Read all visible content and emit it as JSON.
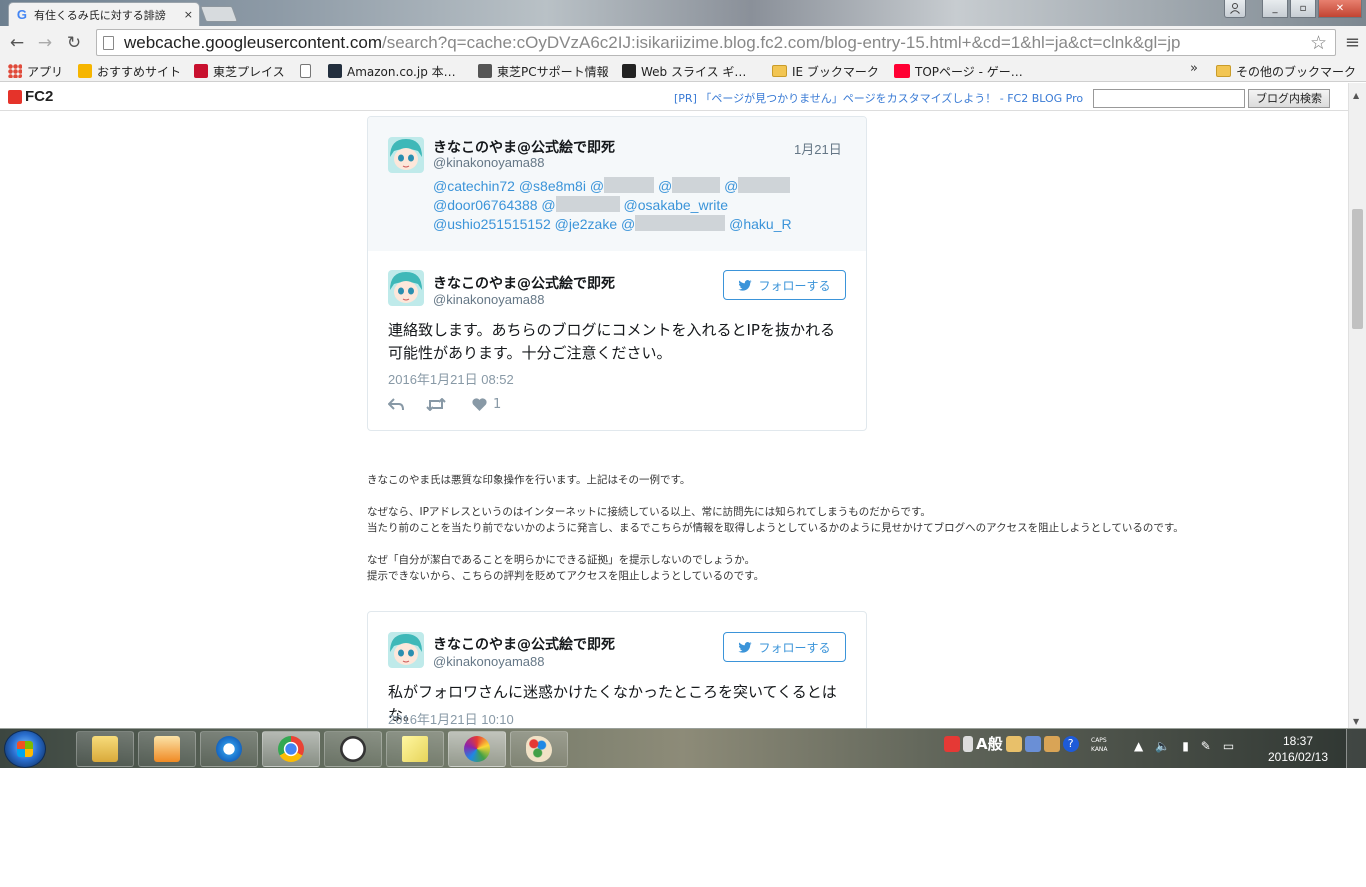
{
  "browser": {
    "tab_title": "有住くるみ氏に対する誹謗",
    "tab_close": "×",
    "url_host": "webcache.googleusercontent.com",
    "url_path": "/search?q=cache:cOyDVzA6c2IJ:isikariizime.blog.fc2.com/blog-entry-15.html+&cd=1&hl=ja&ct=clnk&gl=jp",
    "back": "←",
    "forward": "→",
    "reload": "↻",
    "star": "☆",
    "menu": "≡",
    "win_min": "_",
    "win_max": "▫",
    "win_close": "✕"
  },
  "bookmarks": {
    "items": [
      "アプリ",
      "おすすめサイト",
      "東芝プレイス",
      "",
      "Amazon.co.jp 本…",
      "東芝PCサポート情報",
      "Web スライス ギ…",
      "IE ブックマーク",
      "TOPページ - ゲー…"
    ],
    "more": "»",
    "other": "その他のブックマーク"
  },
  "fc2": {
    "logo": "FC2",
    "pr_text": "[PR] 「ページが見つかりません」ページをカスタマイズしよう！ - FC2 BLOG Pro",
    "search_button": "ブログ内検索",
    "search_value": ""
  },
  "tweet1": {
    "quote": {
      "name": "きなこのやま@公式絵で即死",
      "handle": "@kinakonoyama88",
      "date": "1月21日",
      "mention_1": "@catechin72",
      "mention_2": "@s8e8m8i",
      "mention_3": "@",
      "mention_4": "@",
      "mention_5": "@",
      "mention_6": "@door06764388",
      "mention_7": "@",
      "mention_8": "@osakabe_write",
      "mention_9": "@ushio251515152",
      "mention_10": "@je2zake",
      "mention_11": "@",
      "mention_12": "@haku_R"
    },
    "name": "きなこのやま@公式絵で即死",
    "handle": "@kinakonoyama88",
    "follow": "フォローする",
    "body": "連絡致します。あちらのブログにコメントを入れるとIPを抜かれる可能性があります。十分ご注意ください。",
    "time": "2016年1月21日 08:52",
    "likes": "1"
  },
  "article": {
    "lines": [
      "きなこのやま氏は悪質な印象操作を行います。上記はその一例です。",
      "",
      "なぜなら、IPアドレスというのはインターネットに接続している以上、常に訪問先には知られてしまうものだからです。",
      "当たり前のことを当たり前でないかのように発言し、まるでこちらが情報を取得しようとしているかのように見せかけてブログへのアクセスを阻止しようとしているのです。",
      "",
      "なぜ「自分が潔白であることを明らかにできる証拠」を提示しないのでしょうか。",
      "提示できないから、こちらの評判を貶めてアクセスを阻止しようとしているのです。"
    ]
  },
  "tweet2": {
    "name": "きなこのやま@公式絵で即死",
    "handle": "@kinakonoyama88",
    "follow": "フォローする",
    "body": "私がフォロワさんに迷惑かけたくなかったところを突いてくるとはな。",
    "time": "2016年1月21日 10:10"
  },
  "taskbar": {
    "ime_label": "A般",
    "caps": "CAPS",
    "kana": "KANA",
    "time": "18:37",
    "date": "2016/02/13"
  }
}
